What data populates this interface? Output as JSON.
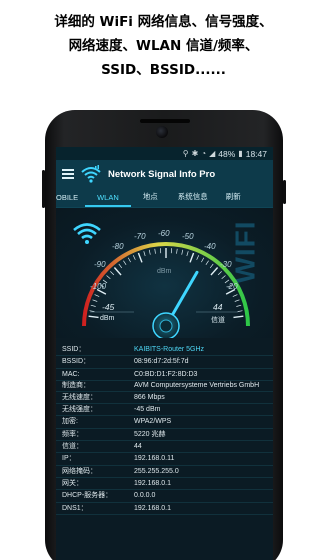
{
  "promo": {
    "line1": "详细的 WiFi 网络信息、信号强度、",
    "line2": "网络速度、WLAN 信道/频率、",
    "line3": "SSID、BSSID......"
  },
  "statusbar": {
    "battery": "48%",
    "time": "18:47"
  },
  "app": {
    "title": "Network Signal Info Pro"
  },
  "tabs": [
    "OBILE",
    "WLAN",
    "地点",
    "系统信息",
    "刷新"
  ],
  "active_tab": "WLAN",
  "gauge": {
    "scale": [
      "-100",
      "-90",
      "-80",
      "-70",
      "-60",
      "-50",
      "-40",
      "-30",
      "-20"
    ],
    "unit": "dBm",
    "watermark": "WIFI",
    "left_value": "-45",
    "left_label": "dBm",
    "right_value": "44",
    "right_label": "信道",
    "needle_dbm": -45
  },
  "info": [
    {
      "key": "SSID：",
      "value": "KAIBITS-Router 5GHz"
    },
    {
      "key": "BSSID：",
      "value": "08:96:d7:2d:5f:7d"
    },
    {
      "key": "MAC:",
      "value": "C0:BD:D1:F2:8D:D3"
    },
    {
      "key": "制造商：",
      "value": "AVM Computersysteme Vertriebs GmbH"
    },
    {
      "key": "无线速度：",
      "value": "866 Mbps"
    },
    {
      "key": "无线强度：",
      "value": "-45 dBm"
    },
    {
      "key": "加密:",
      "value": "WPA2/WPS"
    },
    {
      "key": "频率：",
      "value": "5220 兆赫"
    },
    {
      "key": "信道：",
      "value": "44"
    },
    {
      "key": "IP：",
      "value": "192.168.0.11"
    },
    {
      "key": "网络掩码：",
      "value": "255.255.255.0"
    },
    {
      "key": "网关：",
      "value": "192.168.0.1"
    },
    {
      "key": "DHCP-服务器：",
      "value": "0.0.0.0"
    },
    {
      "key": "DNS1：",
      "value": "192.168.0.1"
    }
  ],
  "colors": {
    "accent": "#36c9ef",
    "appbar": "#0d3a4a",
    "screen_bg": "#0b1b24"
  }
}
